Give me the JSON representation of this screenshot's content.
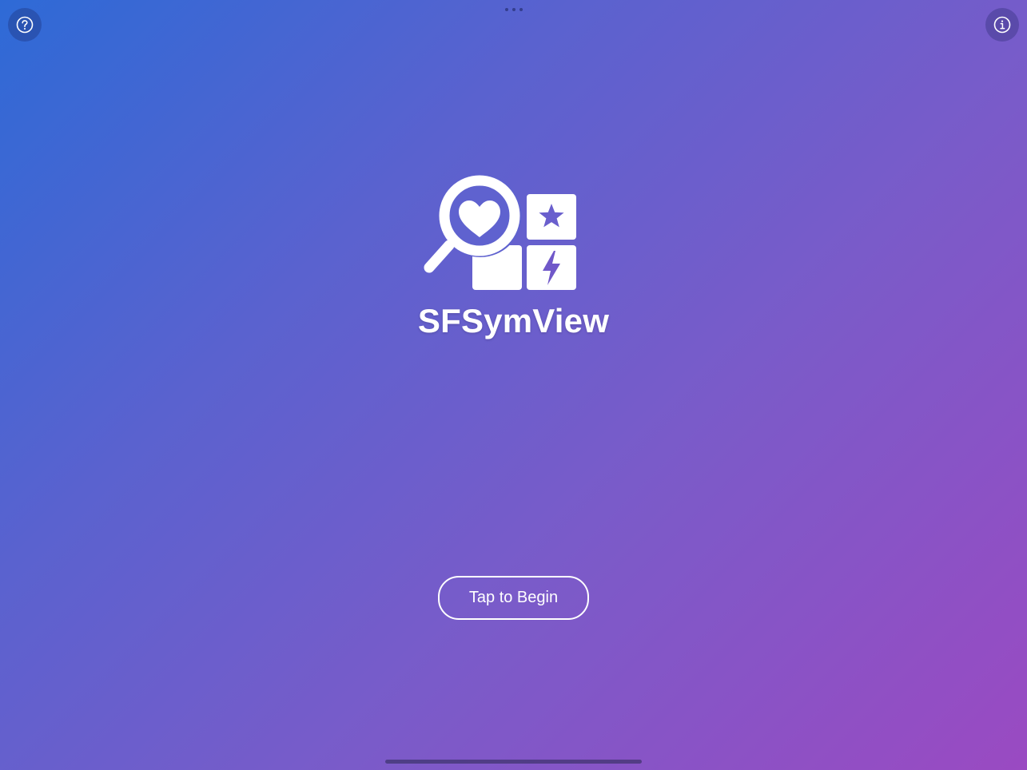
{
  "app": {
    "title": "SFSymView"
  },
  "actions": {
    "begin_label": "Tap to Begin"
  },
  "toolbar": {
    "help_icon": "questionmark-circle-icon",
    "info_icon": "info-circle-icon"
  },
  "logo": {
    "icons": [
      "magnifyingglass-heart-icon",
      "star-icon",
      "bolt-icon",
      "square-icon"
    ]
  },
  "colors": {
    "gradient_start": "#2e6ad6",
    "gradient_mid": "#7a5bc9",
    "gradient_end": "#9a4ac2",
    "foreground": "#ffffff"
  }
}
